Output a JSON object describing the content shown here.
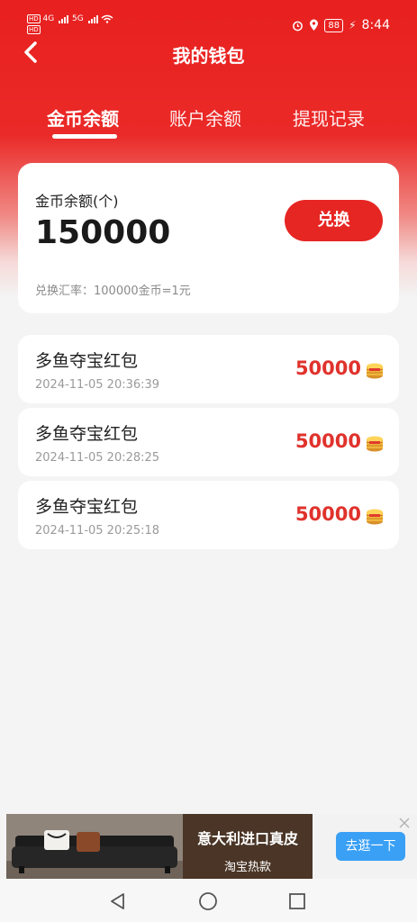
{
  "status_bar": {
    "hd_badges": [
      "HD",
      "HD"
    ],
    "network_labels": [
      "4G",
      "5G"
    ],
    "battery": "88",
    "time": "8:44",
    "icons": [
      "alarm-icon",
      "location-icon",
      "charging-icon",
      "wifi-icon"
    ]
  },
  "header": {
    "title": "我的钱包",
    "back_icon": "chevron-left-icon"
  },
  "tabs": [
    {
      "label": "金币余额",
      "active": true
    },
    {
      "label": "账户余额",
      "active": false
    },
    {
      "label": "提现记录",
      "active": false
    }
  ],
  "balance_card": {
    "label": "金币余额(个)",
    "value": "150000",
    "exchange_button": "兑换",
    "rate_text": "兑换汇率：100000金币=1元"
  },
  "records": [
    {
      "title": "多鱼夺宝红包",
      "datetime": "2024-11-05 20:36:39",
      "amount": "50000",
      "icon": "coin-stack-icon"
    },
    {
      "title": "多鱼夺宝红包",
      "datetime": "2024-11-05 20:28:25",
      "amount": "50000",
      "icon": "coin-stack-icon"
    },
    {
      "title": "多鱼夺宝红包",
      "datetime": "2024-11-05 20:25:18",
      "amount": "50000",
      "icon": "coin-stack-icon"
    }
  ],
  "ad": {
    "title": "意大利进口真皮",
    "subtitle": "淘宝热款",
    "button": "去逛一下",
    "close_icon": "close-icon"
  },
  "nav_bar": {
    "icons": [
      "back-triangle-icon",
      "home-circle-icon",
      "recents-square-icon"
    ]
  },
  "colors": {
    "brand_red": "#e62623",
    "amount_red": "#e0322c",
    "ad_button_blue": "#3aa0f5"
  }
}
